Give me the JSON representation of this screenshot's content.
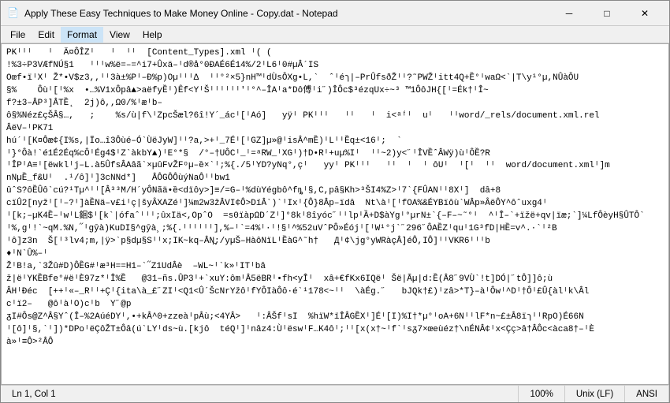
{
  "window": {
    "title": "Apply These Easy Techniques to Make Money Online - Copy.dat - Notepad",
    "icon": "📄"
  },
  "titlebar": {
    "minimize_label": "─",
    "maximize_label": "□",
    "close_label": "✕"
  },
  "menubar": {
    "items": [
      "File",
      "Edit",
      "Format",
      "View",
      "Help"
    ]
  },
  "editor": {
    "content": "PKᴵᴵᴵ   ᴵ  Ä¤ÔÎZᴵ   ᴵ  ᴵᴵ  [Content_Types].xml ᴵ( (\n!%3÷P3VÆfNÚ§1   ᴵᴵᴵw%ë=–=^i7+Ûxä–ᴵd®å°0ÐAÉ6É14%/2ᴵL6ᴵ0#µÂ´IS\nOœf•ïᴵXᴵ Ž*•V$z3,,ᴵᴵ3à±%Pᴵ–Ð%p)OµᴵᴵᴵΔ  ᴵᴵ°²×5}nH™ᴵdÙsÔXg•L,`  ˆᴵéɿ|–PrÛfsðŽᴵᴵ?˜PWŽᴵitt4Q+Ȅ°ᴵwaΩ<`|T\\y¹°µ,NÛàÔU\n§%    Ôùᴵ[ᴵ%x  •…%V1xÔpâ▲>aëfyȄᴵ)Ȇf<YᴵŠᴵᴵᴵᴵᴵᴵ'ᴵ°^–ÎAᴵa*Dô傅ᴵi˝)ÎÔc$³ézqUx÷~³ ™1ÔôJH{[ᴵ=Ék†ᴵÎ~\nf?±3–ÂP³]ÂTȄ˛  2j)ô,,Ω0/%ᴵæᴵb–\nô§%Néz£çŠÂ§…,   ;    %s/ù|f\\ᴵZpcŠæl?6î!Y´_ácᴵ[ᴵAó]   yÿᴵ PKᴵᴵᴵ   ᴵᴵ   ᴵ  i<ᵃᶠᴵ  uᴵ   ᴵᴵword/_rels/document.xml.rel\nÂëV–ᴵPK71\nhú´ᴵ[K¤Ôæ¢{I%s,|Ïo…î3Ôùé–Ó`ÙëJyW]ᴵᴵ?a,>+ᴵ_7Éᴵ[ᴵGZ]µ»@ᴵisÂ^mȄ)ᴵLᴵᴵȄq±<16ᴵ;  `\nᴵ}°Ôà!`é1É2Éq%cÔᴵÉg4$ᴵZ`àkbY▲)ᴵE°*§  /°–†UÔCᴵ_ᴵ=ᵃRW_ᴵXGᴵ)†D•Rᴵ+uµ%Iᴵ  ᴵᴵ~2)y<˝ᴵÎVȄˆÂWÿ)ùᴵÔȄ?R\nᴵÎPᴵA≡ᴵ[ëwklᴵj–L.à5ÛfsÂAâã`×µûFvŽFᵒµ–ȅ×`ᴵ;%{./5ᴵYD?yNq°,çᴵ   yyᴵ PKᴵᴵᴵ   ᴵᴵ  ᴵ  ᴵ ôUᴵ  ᴵ[ᴵ  ᴵᴵ  word/document.xmlᴵ]m\nnNµȄ_f&Uᴵ  .¹/ô]ᴵ]3cNNd*]   ÂÔGÔÔùýNaÔᴵᴵbw1\nûˆS?ôȄÛô`cú?¹Tµ^ᴵᴵ[Â³³M/H´yÔNãä•ȅ<dïôy>]≡/=G–ᴵ%dùYégbô^fȵᴵ§,C,pȃ§Kh>³ŠΙ4%Z>ᴵ7`{FÛANᴵᴵ8Xᴵ]  dȃ+8\ncïÛ2[nyžᴵ[ᴵ–?ᴵ]àȄNä–v£iᴵç|šyȂXAZéᴵ]¼m2w3žÂVΙ¢Ô>DïÂ`)`ᴵΙxᴵ{Ô}8Âp–ïdȃ  Nt\\àᴵ[ᴵfOA%&ÉYBïôù`WÂp»ȂëÔY^ôˆuxg4ᴵ\nᴵ[k;–µK4Ȅ–ᴵwᴵL䤧$ᴵ[k`|ófaˆᴵᴵᴵ;ûxΙä<,OpˆO  =s0ïàpΩDˊZᴵ]°8kᴵ8îyóc˝ᴵᴵlpᴵȀ+D$àYgᴵ°µrN±`{–F–~˜°ᴵ  ^ᴵÎ–`+ïžë+qv|ïæ;`]¼LfÔèyH§ÛTÔ`\nᴵ%,gᴵ!`~qM.%N,᳓ᴵgȳà)KuDΙ§^gȳà¸;%{.ᴵᴵᴵᴵᴵᴵ],%–ᴵ`=4%ᴵ·ᴵ!§ᴵ^%52uVˆPÔ»Éójᴵ[ᴵW¹°j`˝296˝ÔAȄZᴵquᴵ1G³fD|HȄ=v^.·`ᴵ²Β\nᴵô]z3n  Š[ᴵ³lv4;m,|ÿ>`p§dµ§Sᴵᴵx;ΙK~kq–ÂN̪;/yµŠ–HàôNïLᴵȄàG^˜h†   Дᴵ¢\\jg°yWRàçÂ]éÔ,ΙÔ]ᴵᴵVKR6ᴵᴵᴵb\n♦ᴵN`Û%–ᴵ\nŽᴵ]B!a,`3Žû#D)ÔȄG#ᴵæ³H==H1–`᳓Z1UdÂè  –WL~ᴵ`k»ᴵΙTᴵbâ\nž|ëᴵYKȄBfe°#ëᴵÈ97z*ᴵÎ%Ȅ   @31–ñs.ÛP3ᴵ+`xuY:ômᴵÂ5ëBRᴵ•fh<yÎᴵ  xâ+€fKx6IQëᴵ Šë|Ãµ|d:Ȅ(Â8˝9VÙ`!t]DÓ|˝tÔ]]ô;ù\nÂHᴵÐéc  [++ᴵ«–_Rᴵᴵ+Çᴵ{ita\\à_£˝ZΙᴵ<Q1<ÛˊŠcNrYžôᴵfYÔΙàÔȏ·é`¹178<~ᴵᴵ  \\àÉg.˝   bJQk†£)ᴵzâ>*T}–àᴵÔwᴵ^Dᴵ†Ôᴵ£Û{àlᴵk\\Âl\ncᴵï2–   @ôᴵàᴵO)cᴵb  Y˝@p\nᵹΙ#Ôs@Z^Â§Yˆ(Î–%2AúéDYᴵ,•+kÂ^0+zzeàᴵpÂù;<4YÂ>   ᴵ:ÂŠfᴵsΙ  %hïW*ïÎÂGȄXᴵ]Éᴵ[Ι)%Ι†*µ°ᴵoA+6NᴵᴵlF*n~£±Â8ïɿᴵᴵRpO)É66N\nᴵ[ô]ᴵ§,`ᴵ])*DPoᴵëÇôŽT±Ôȃ(ú`LYᴵds~ù.[kjô  téQᴵ]ᴵnâz4:ÙᴵëswᴵF…K4ôᴵ;ᴵᴵ[x(x†~ᴵf`ᴵsᵹ7×œeùéz†\nÉNÂ¢ᴵx<Çç>â†ÂÔc<àca8†–ᴵÈ\nà»ᴵ≡Ô>²ÂÔ"
  },
  "statusbar": {
    "position": "Ln 1, Col 1",
    "zoom": "100%",
    "line_ending": "Unix (LF)",
    "encoding": "ANSI"
  },
  "colors": {
    "background": "#f0f0f0",
    "editor_bg": "#ffffff",
    "text": "#000000",
    "border": "#aaaaaa"
  }
}
